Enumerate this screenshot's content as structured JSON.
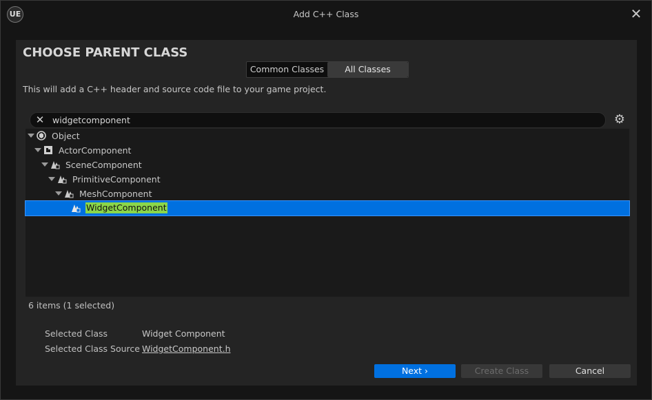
{
  "window": {
    "title": "Add C++ Class",
    "logo": "UE"
  },
  "heading": "CHOOSE PARENT CLASS",
  "tabs": [
    {
      "label": "Common Classes",
      "active": false
    },
    {
      "label": "All Classes",
      "active": true
    }
  ],
  "description": "This will add a C++ header and source code file to your game project.",
  "search": {
    "value": "widgetcomponent"
  },
  "tree": [
    {
      "label": "Object",
      "icon": "object-icon"
    },
    {
      "label": "ActorComponent",
      "icon": "actor-component-icon"
    },
    {
      "label": "SceneComponent",
      "icon": "scene-component-icon"
    },
    {
      "label": "PrimitiveComponent",
      "icon": "scene-component-icon"
    },
    {
      "label": "MeshComponent",
      "icon": "scene-component-icon"
    },
    {
      "label": "WidgetComponent",
      "icon": "scene-component-icon",
      "selected": true
    }
  ],
  "status": "6 items (1 selected)",
  "details": {
    "selected_class_label": "Selected Class",
    "selected_class_value": "Widget Component",
    "source_label": "Selected Class Source",
    "source_value": "WidgetComponent.h"
  },
  "buttons": {
    "next": "Next",
    "create": "Create Class",
    "cancel": "Cancel"
  },
  "colors": {
    "accent": "#0070e0",
    "highlight": "#8bd64a",
    "panel": "#242424"
  }
}
